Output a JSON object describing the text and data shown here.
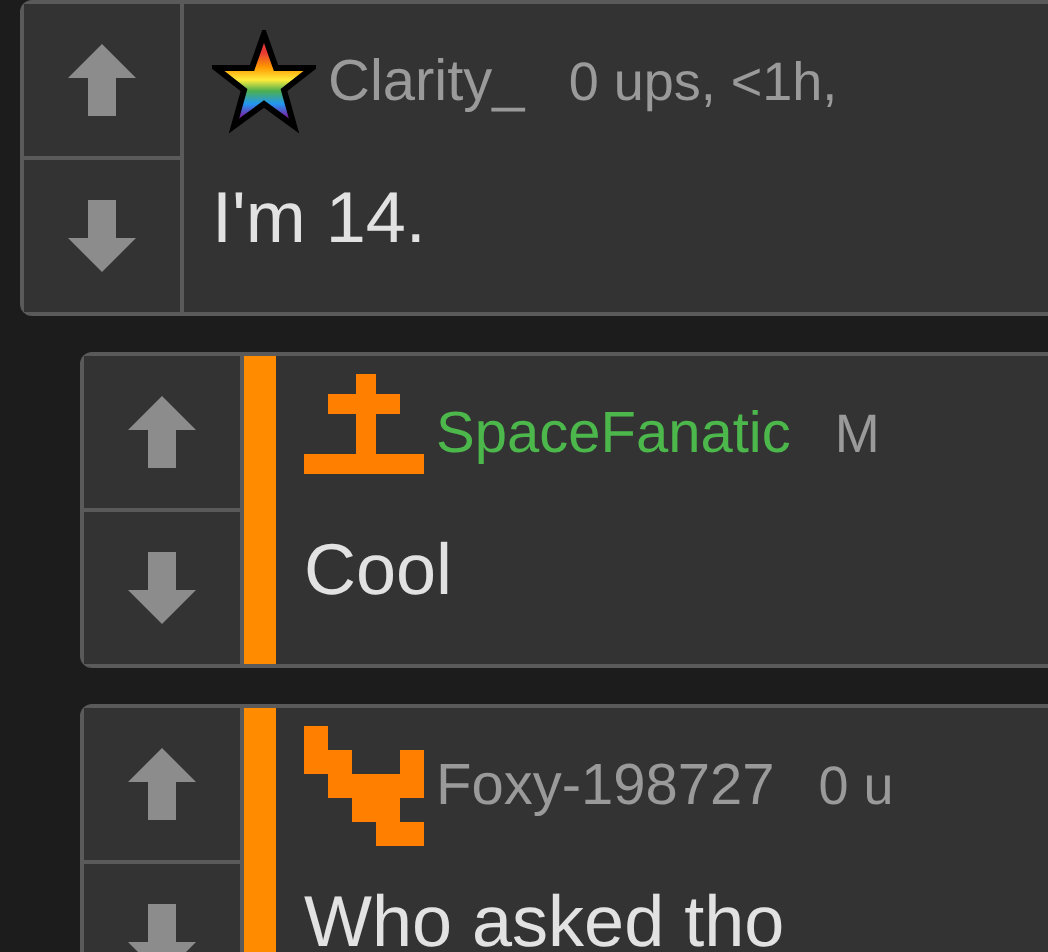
{
  "comments": [
    {
      "username": "Clarity_",
      "color": "#9a9a9a",
      "avatar": {
        "kind": "star"
      },
      "meta": "0 ups, <1h,",
      "text": "I'm 14.",
      "children": [
        {
          "username": "SpaceFanatic",
          "color": "#4cb84c",
          "avatar": {
            "kind": "cross"
          },
          "meta": "M",
          "text": "Cool"
        },
        {
          "username": "Foxy-198727",
          "color": "#9a9a9a",
          "avatar": {
            "kind": "pixel"
          },
          "meta": "0 u",
          "text": "Who asked tho"
        }
      ]
    }
  ]
}
